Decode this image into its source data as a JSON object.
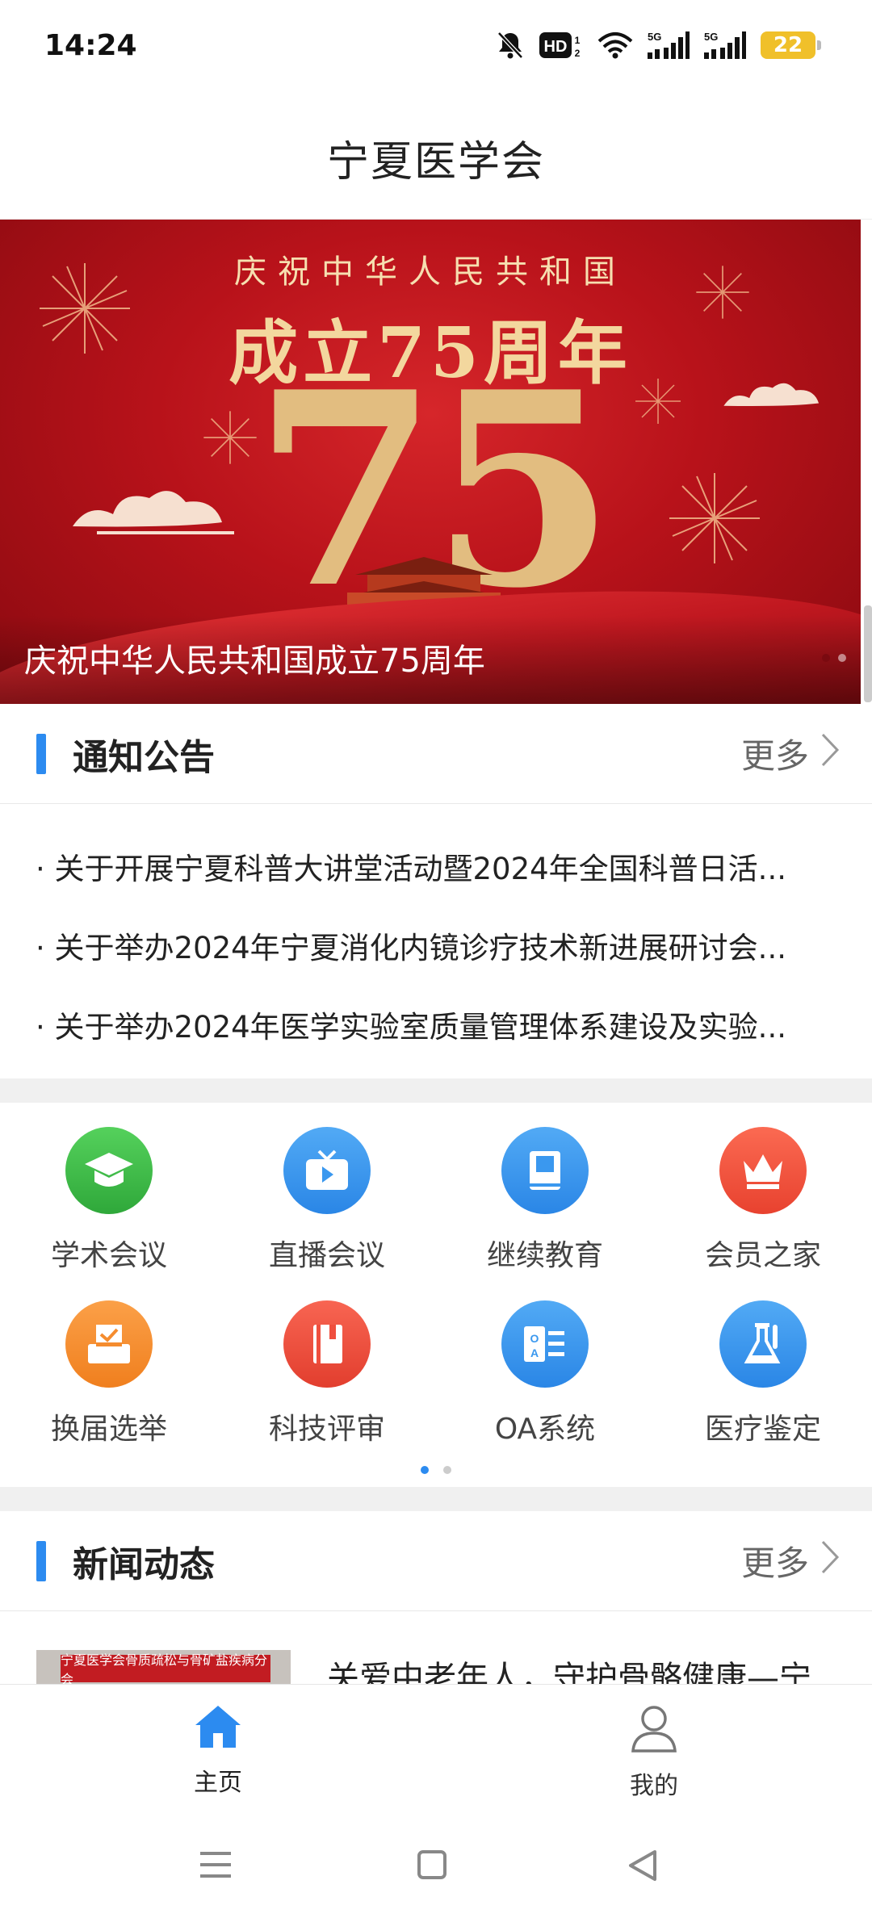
{
  "status_bar": {
    "time": "14:24",
    "battery": "22",
    "icons": [
      "mute-bell-icon",
      "hd-icon",
      "wifi-icon",
      "signal-5g-icon",
      "signal-5g-icon",
      "battery-icon"
    ],
    "hd": "HD",
    "net1": "5G",
    "net2": "5G"
  },
  "header": {
    "title": "宁夏医学会"
  },
  "banner": {
    "heading_line1": "庆祝中华人民共和国",
    "heading_line2": "成立75周年",
    "big_number": "75",
    "caption": "庆祝中华人民共和国成立75周年",
    "slide_count": 2,
    "active_slide": 1
  },
  "notices": {
    "title": "通知公告",
    "more": "更多",
    "items": [
      "· 关于开展宁夏科普大讲堂活动暨2024年全国科普日活...",
      "· 关于举办2024年宁夏消化内镜诊疗技术新进展研讨会...",
      "· 关于举办2024年医学实验室质量管理体系建设及实验..."
    ]
  },
  "features": {
    "items": [
      {
        "label": "学术会议",
        "icon": "graduation-cap-icon",
        "color": "#3fbf4a"
      },
      {
        "label": "直播会议",
        "icon": "tv-icon",
        "color": "#3a98ef"
      },
      {
        "label": "继续教育",
        "icon": "book-icon",
        "color": "#3a98ef"
      },
      {
        "label": "会员之家",
        "icon": "crown-icon",
        "color": "#f05a44"
      },
      {
        "label": "换届选举",
        "icon": "ballot-box-icon",
        "color": "#f58c2e"
      },
      {
        "label": "科技评审",
        "icon": "notebook-icon",
        "color": "#ef4f3e"
      },
      {
        "label": "OA系统",
        "icon": "oa-card-icon",
        "color": "#3a98ef"
      },
      {
        "label": "医疗鉴定",
        "icon": "flask-icon",
        "color": "#3a98ef"
      }
    ],
    "page_count": 2,
    "active_page": 1
  },
  "news": {
    "title": "新闻动态",
    "more": "更多",
    "items": [
      {
        "title": "关爱中老年人，守护骨骼健康—宁",
        "thumb_text": "宁夏医学会骨质疏松与骨矿盐疾病分会"
      }
    ]
  },
  "tab_bar": {
    "tabs": [
      {
        "label": "主页",
        "icon": "home-icon",
        "active": true
      },
      {
        "label": "我的",
        "icon": "user-icon",
        "active": false
      }
    ],
    "active_color": "#2c8bf0",
    "inactive_color": "#555555"
  },
  "nav_bar": {
    "buttons": [
      "menu-icon",
      "home-square-icon",
      "back-triangle-icon"
    ]
  }
}
